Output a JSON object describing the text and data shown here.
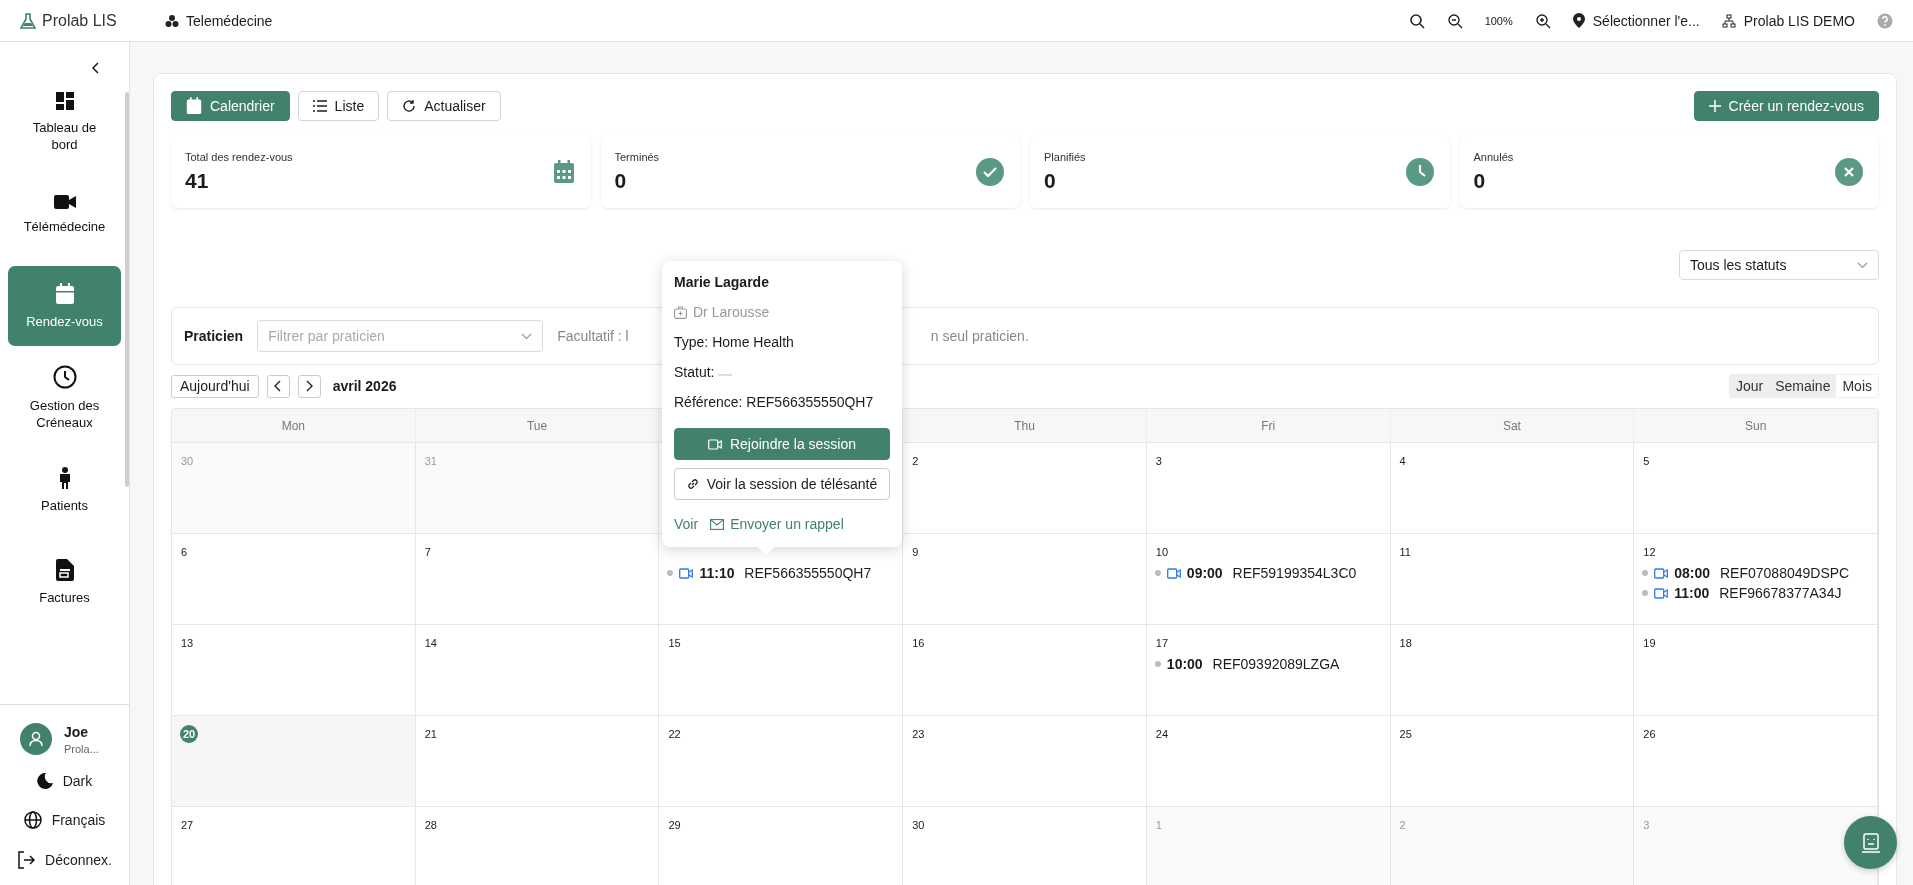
{
  "topbar": {
    "brand": "Prolab LIS",
    "module": "Telemédecine",
    "zoom": "100%",
    "location": "Sélectionner l'e...",
    "organization": "Prolab LIS DEMO"
  },
  "sidebar": {
    "items": [
      {
        "kind": "dashboard",
        "label": "Tableau de bord",
        "selected": false
      },
      {
        "kind": "video",
        "label": "Télémédecine",
        "selected": false
      },
      {
        "kind": "calendar",
        "label": "Rendez-vous",
        "selected": true
      },
      {
        "kind": "clock",
        "label": "Gestion des Créneaux",
        "selected": false
      },
      {
        "kind": "person",
        "label": "Patients",
        "selected": false
      },
      {
        "kind": "invoice",
        "label": "Factures",
        "selected": false
      }
    ],
    "user": {
      "name": "Joe",
      "org": "Prola..."
    },
    "footer": [
      {
        "kind": "theme",
        "label": "Dark"
      },
      {
        "kind": "language",
        "label": "Français"
      },
      {
        "kind": "logout",
        "label": "Déconnex."
      }
    ]
  },
  "toolbar": {
    "views": [
      {
        "kind": "calendar",
        "label": "Calendrier",
        "selected": true
      },
      {
        "kind": "list",
        "label": "Liste",
        "selected": false
      }
    ],
    "refresh": "Actualiser",
    "create": "Créer un rendez-vous"
  },
  "stats": [
    {
      "label": "Total des rendez-vous",
      "value": "41",
      "kind": "total"
    },
    {
      "label": "Terminés",
      "value": "0",
      "kind": "done"
    },
    {
      "label": "Planifiés",
      "value": "0",
      "kind": "planned"
    },
    {
      "label": "Annulés",
      "value": "0",
      "kind": "cancelled"
    }
  ],
  "status_filter": {
    "value": "Tous les statuts"
  },
  "practitioner_filter": {
    "label": "Praticien",
    "placeholder": "Filtrer par praticien",
    "hint_parts": [
      "Facultatif : l",
      "n seul praticien."
    ]
  },
  "calendar": {
    "today_button": "Aujourd'hui",
    "month": "avril 2026",
    "modes": [
      {
        "label": "Jour",
        "selected": false
      },
      {
        "label": "Semaine",
        "selected": false
      },
      {
        "label": "Mois",
        "selected": true
      }
    ],
    "day_headers": [
      "Mon",
      "Tue",
      "Thu",
      "Fri",
      "Sat",
      "Sun"
    ],
    "weeks": [
      [
        {
          "day": "30",
          "muted": true,
          "today": false
        },
        {
          "day": "31",
          "muted": true,
          "today": false
        },
        {
          "under_popover": true
        },
        {
          "day": "2",
          "muted": false,
          "today": false
        },
        {
          "day": "3",
          "muted": false,
          "today": false
        },
        {
          "day": "4",
          "muted": false,
          "today": false
        },
        {
          "day": "5",
          "muted": false,
          "today": false
        }
      ],
      [
        {
          "day": "6",
          "muted": false,
          "today": false
        },
        {
          "day": "7",
          "muted": false,
          "today": false
        },
        {
          "muted": false,
          "today": false,
          "events": [
            {
              "time": "11:10",
              "ref": "REF566355550QH7",
              "video": true
            }
          ]
        },
        {
          "day": "9",
          "muted": false,
          "today": false
        },
        {
          "day": "10",
          "muted": false,
          "today": false,
          "events": [
            {
              "time": "09:00",
              "ref": "REF59199354L3C0",
              "video": true
            }
          ]
        },
        {
          "day": "11",
          "muted": false,
          "today": false
        },
        {
          "day": "12",
          "muted": false,
          "today": false,
          "events": [
            {
              "time": "08:00",
              "ref": "REF07088049DSPC",
              "video": true
            },
            {
              "time": "11:00",
              "ref": "REF96678377A34J",
              "video": true
            }
          ]
        }
      ],
      [
        {
          "day": "13",
          "muted": false,
          "today": false
        },
        {
          "day": "14",
          "muted": false,
          "today": false
        },
        {
          "day": "15",
          "muted": false,
          "today": false
        },
        {
          "day": "16",
          "muted": false,
          "today": false
        },
        {
          "day": "17",
          "muted": false,
          "today": false,
          "events": [
            {
              "time": "10:00",
              "ref": "REF09392089LZGA",
              "video": false
            }
          ]
        },
        {
          "day": "18",
          "muted": false,
          "today": false
        },
        {
          "day": "19",
          "muted": false,
          "today": false
        }
      ],
      [
        {
          "day": "20",
          "muted": false,
          "today": true
        },
        {
          "day": "21",
          "muted": false,
          "today": false
        },
        {
          "day": "22",
          "muted": false,
          "today": false
        },
        {
          "day": "23",
          "muted": false,
          "today": false
        },
        {
          "day": "24",
          "muted": false,
          "today": false
        },
        {
          "day": "25",
          "muted": false,
          "today": false
        },
        {
          "day": "26",
          "muted": false,
          "today": false
        }
      ],
      [
        {
          "day": "27",
          "muted": false,
          "today": false
        },
        {
          "day": "28",
          "muted": false,
          "today": false
        },
        {
          "day": "29",
          "muted": false,
          "today": false
        },
        {
          "day": "30",
          "muted": false,
          "today": false
        },
        {
          "day": "1",
          "muted": true,
          "today": false
        },
        {
          "day": "2",
          "muted": true,
          "today": false
        },
        {
          "day": "3",
          "muted": true,
          "today": false
        }
      ]
    ]
  },
  "popover": {
    "patient": "Marie Lagarde",
    "doctor": "Dr Larousse",
    "type": "Type: Home Health",
    "status_label": "Statut:",
    "reference": "Référence: REF566355550QH7",
    "join": "Rejoindre la session",
    "view_session": "Voir la session de télésanté",
    "links": [
      "Voir",
      "Envoyer un rappel"
    ]
  }
}
